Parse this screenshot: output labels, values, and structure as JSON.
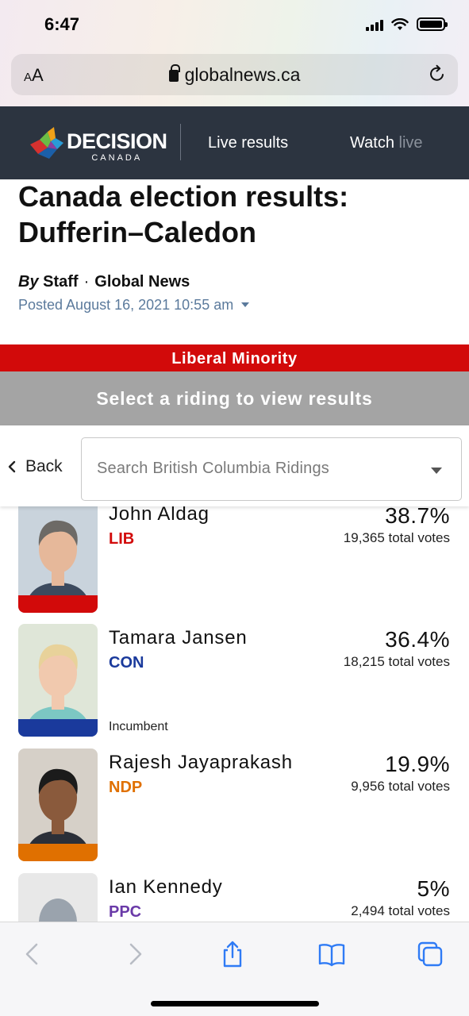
{
  "status_bar": {
    "time": "6:47"
  },
  "browser": {
    "text_size_label": "AA",
    "url": "globalnews.ca"
  },
  "site_header": {
    "logo_line1": "DECISION",
    "logo_line2": "CANADA",
    "nav_live": "Live results",
    "nav_watch": "Watch live"
  },
  "article": {
    "title": "Canada election results: Dufferin–Caledon",
    "byline_by": "By",
    "byline_author": "Staff",
    "byline_separator": "·",
    "byline_outlet": "Global News",
    "posted": "Posted August 16, 2021 10:55 am"
  },
  "results": {
    "banner": "Liberal Minority",
    "select_prompt": "Select a riding to view results",
    "back_label": "Back",
    "search_placeholder": "Search British Columbia Ridings"
  },
  "colors": {
    "LIB": "#d20a0a",
    "CON": "#1a3a9c",
    "NDP": "#e07000",
    "PPC": "#6a3aa8",
    "header_bg": "#2c3440"
  },
  "candidates": [
    {
      "name": "John Aldag",
      "party": "LIB",
      "percent": "38.7%",
      "votes": "19,365 total votes",
      "incumbent": ""
    },
    {
      "name": "Tamara Jansen",
      "party": "CON",
      "percent": "36.4%",
      "votes": "18,215 total votes",
      "incumbent": "Incumbent"
    },
    {
      "name": "Rajesh Jayaprakash",
      "party": "NDP",
      "percent": "19.9%",
      "votes": "9,956 total votes",
      "incumbent": ""
    },
    {
      "name": "Ian Kennedy",
      "party": "PPC",
      "percent": "5%",
      "votes": "2,494 total votes",
      "incumbent": ""
    }
  ],
  "toolbar": {
    "icons": [
      "back-arrow-icon",
      "forward-arrow-icon",
      "share-icon",
      "bookmarks-icon",
      "tabs-icon"
    ]
  }
}
